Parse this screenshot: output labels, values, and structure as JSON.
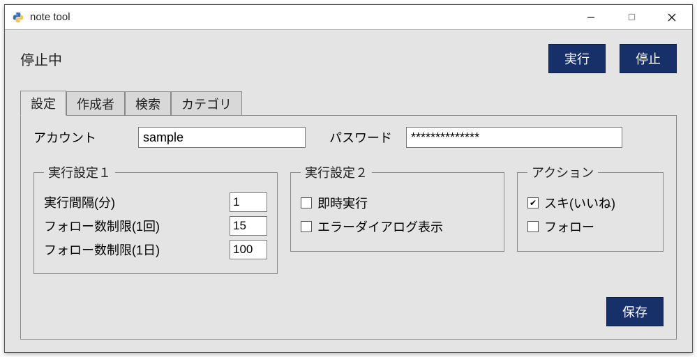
{
  "window": {
    "title": "note tool"
  },
  "status": "停止中",
  "buttons": {
    "run": "実行",
    "stop": "停止",
    "save": "保存"
  },
  "tabs": {
    "t0": "設定",
    "t1": "作成者",
    "t2": "検索",
    "t3": "カテゴリ"
  },
  "account": {
    "label": "アカウント",
    "value": "sample"
  },
  "password": {
    "label": "パスワード",
    "value": "**************"
  },
  "group1": {
    "legend": "実行設定１",
    "interval_label": "実行間隔(分)",
    "interval_value": "1",
    "limit_once_label": "フォロー数制限(1回)",
    "limit_once_value": "15",
    "limit_day_label": "フォロー数制限(1日)",
    "limit_day_value": "100"
  },
  "group2": {
    "legend": "実行設定２",
    "immediate_label": "即時実行",
    "immediate_checked": false,
    "errdlg_label": "エラーダイアログ表示",
    "errdlg_checked": false
  },
  "group3": {
    "legend": "アクション",
    "like_label": "スキ(いいね)",
    "like_checked": true,
    "follow_label": "フォロー",
    "follow_checked": false
  }
}
